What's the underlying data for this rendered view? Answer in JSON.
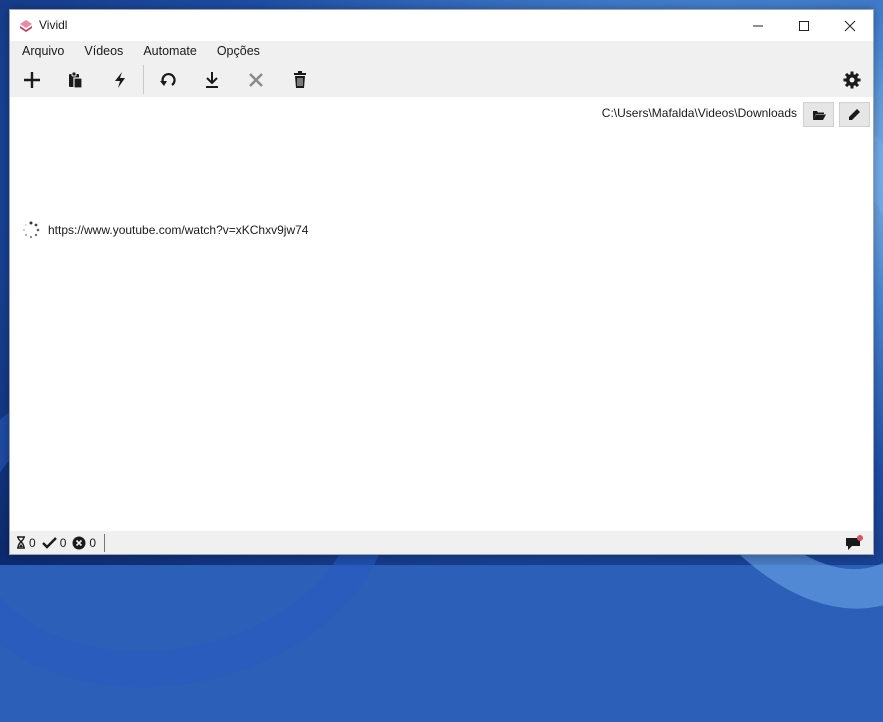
{
  "window": {
    "title": "Vividl"
  },
  "menu": {
    "items": [
      "Arquivo",
      "Vídeos",
      "Automate",
      "Opções"
    ]
  },
  "toolbar": {
    "buttons": [
      "plus-icon",
      "paste-icon",
      "lightning-icon",
      "refresh-icon",
      "download-icon",
      "cancel-icon",
      "trash-icon"
    ],
    "settings": "gear-icon"
  },
  "download_dir": {
    "path": "C:\\Users\\Mafalda\\Videos\\Downloads"
  },
  "items": [
    {
      "url": "https://www.youtube.com/watch?v=xKChxv9jw74",
      "state": "loading"
    }
  ],
  "status": {
    "pending": "0",
    "done": "0",
    "failed": "0"
  },
  "colors": {
    "accent_icon": "#c0395a",
    "notification_dot": "#e05060",
    "disabled_icon": "#8a8a8a"
  }
}
